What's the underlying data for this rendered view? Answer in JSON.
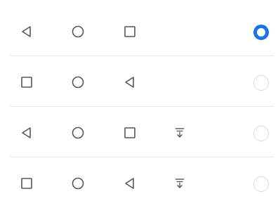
{
  "navigation_bar_options": [
    {
      "buttons": [
        "back-icon",
        "home-icon",
        "recents-icon"
      ],
      "selected": true
    },
    {
      "buttons": [
        "recents-icon",
        "home-icon",
        "back-icon"
      ],
      "selected": false
    },
    {
      "buttons": [
        "back-icon",
        "home-icon",
        "recents-icon",
        "notification-pull-down-icon"
      ],
      "selected": false
    },
    {
      "buttons": [
        "recents-icon",
        "home-icon",
        "back-icon",
        "notification-pull-down-icon"
      ],
      "selected": false
    }
  ],
  "colors": {
    "accent": "#1a73e8",
    "icon": "#555555",
    "radio_unselected_border": "#d9d9d9",
    "divider": "#eaeaea",
    "background": "#ffffff"
  }
}
